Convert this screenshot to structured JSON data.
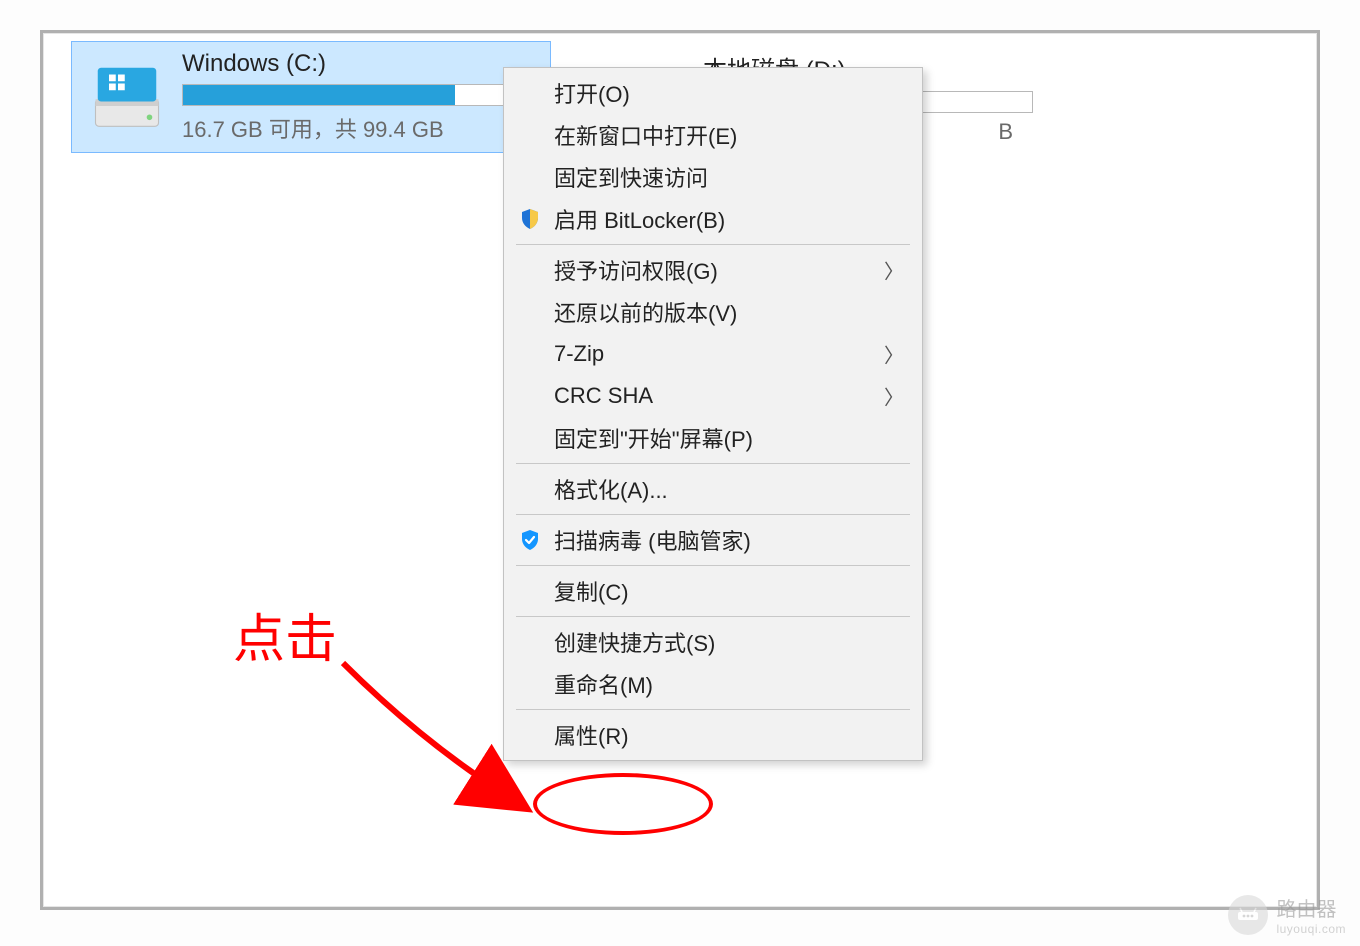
{
  "drive_c": {
    "name": "Windows (C:)",
    "usage_text": "16.7 GB 可用，共 99.4 GB",
    "fill_percent": 83
  },
  "drive_d": {
    "name_partial": "本地磁盘 (D:)",
    "usage_suffix": "B"
  },
  "context_menu": {
    "open": "打开(O)",
    "open_new_window": "在新窗口中打开(E)",
    "pin_quick_access": "固定到快速访问",
    "bitlocker": "启用 BitLocker(B)",
    "grant_access": "授予访问权限(G)",
    "restore_previous": "还原以前的版本(V)",
    "seven_zip": "7-Zip",
    "crc_sha": "CRC SHA",
    "pin_start": "固定到\"开始\"屏幕(P)",
    "format": "格式化(A)...",
    "scan_virus": "扫描病毒 (电脑管家)",
    "copy": "复制(C)",
    "create_shortcut": "创建快捷方式(S)",
    "rename": "重命名(M)",
    "properties": "属性(R)"
  },
  "annotation": {
    "label": "点击"
  },
  "watermark": {
    "title": "路由器",
    "sub": "luyouqi.com"
  }
}
